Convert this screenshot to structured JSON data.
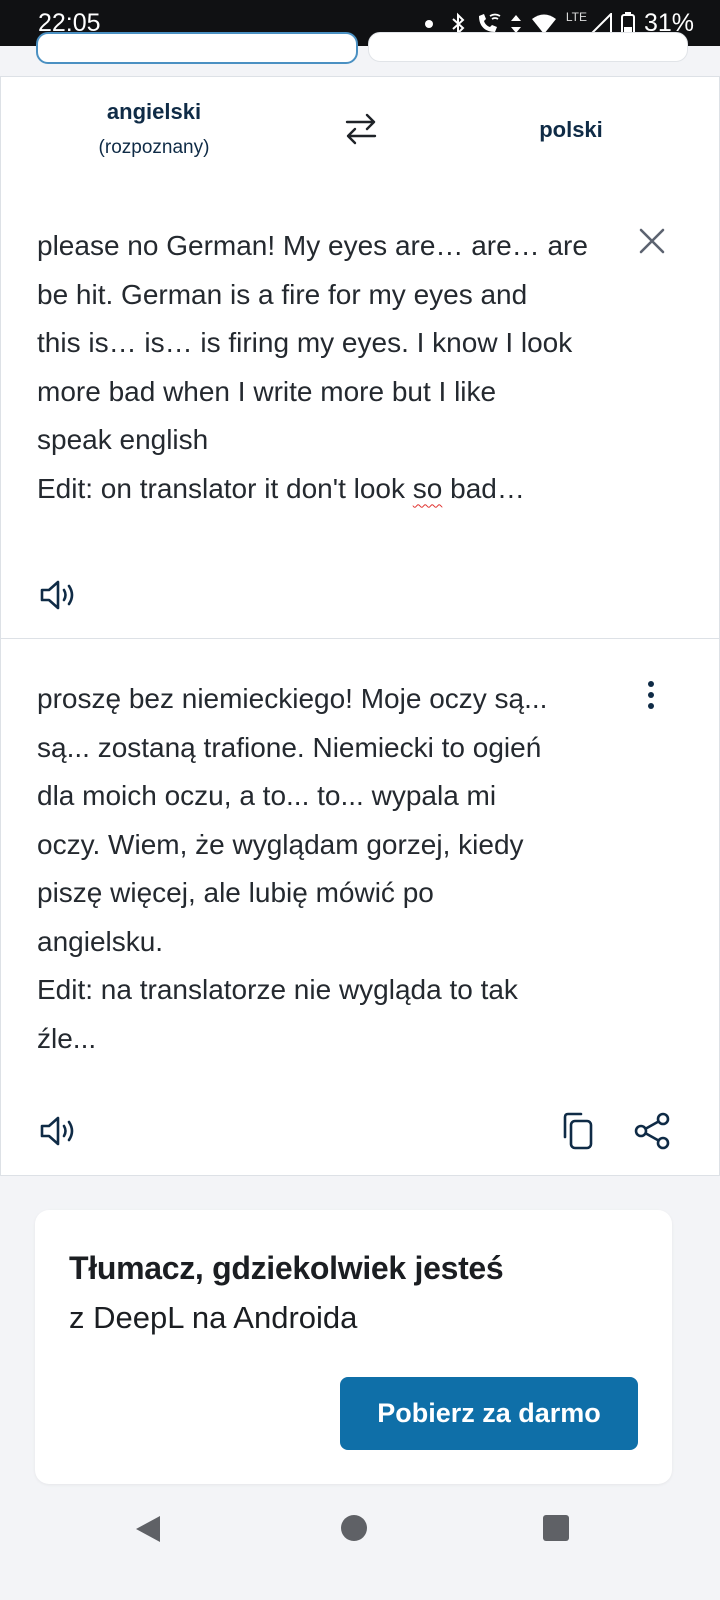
{
  "status_bar": {
    "time": "22:05",
    "network": "LTE",
    "battery": "31%"
  },
  "languages": {
    "source_name": "angielski",
    "source_detected": "(rozpoznany)",
    "target_name": "polski"
  },
  "source": {
    "text_before": "please no German! My eyes are… are… are\nbe hit. German is a fire for my eyes and\nthis is… is… is firing my eyes. I know I look\nmore bad when I write more but I like\nspeak english\nEdit: on translator it don't look ",
    "text_flagged": "so",
    "text_after": " bad…"
  },
  "target": {
    "text": "proszę bez niemieckiego! Moje oczy są...\nsą... zostaną trafione. Niemiecki to ogień\ndla moich oczu, a to... to... wypala mi\noczy. Wiem, że wyglądam gorzej, kiedy\npiszę więcej, ale lubię mówić po\nangielsku.\nEdit: na translatorze nie wygląda to tak\nźle..."
  },
  "promo": {
    "title": "Tłumacz, gdziekolwiek jesteś",
    "subtitle": "z DeepL na Androida",
    "button_label": "Pobierz za darmo"
  },
  "colors": {
    "accent": "#0f6fa8",
    "text_dark": "#0f2b46",
    "spell_error": "#e0322f"
  },
  "icons": [
    "swap-icon",
    "close-icon",
    "speaker-icon",
    "more-vertical-icon",
    "copy-icon",
    "share-icon"
  ]
}
